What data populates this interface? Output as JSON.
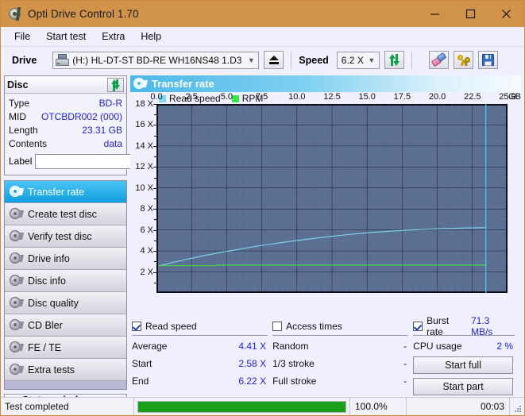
{
  "window": {
    "title": "Opti Drive Control 1.70",
    "minimize": "minimize-icon",
    "maximize": "maximize-icon",
    "close": "close-icon"
  },
  "menu": {
    "items": [
      {
        "label": "File"
      },
      {
        "label": "Start test"
      },
      {
        "label": "Extra"
      },
      {
        "label": "Help"
      }
    ]
  },
  "drivebar": {
    "drive_label": "Drive",
    "drive_value": "(H:)  HL-DT-ST BD-RE  WH16NS48 1.D3",
    "eject": "eject-button",
    "speed_label": "Speed",
    "speed_value": "6.2 X",
    "refresh": "refresh-button",
    "erase": "erase-button",
    "tools": "tools-button",
    "save": "save-button"
  },
  "disc": {
    "header": "Disc",
    "refresh": "refresh-disc-button",
    "rows": [
      {
        "key": "Type",
        "value": "BD-R"
      },
      {
        "key": "MID",
        "value": "OTCBDR002 (000)"
      },
      {
        "key": "Length",
        "value": "23.31 GB"
      },
      {
        "key": "Contents",
        "value": "data"
      }
    ],
    "label_key": "Label",
    "label_value": "",
    "label_placeholder": ""
  },
  "tabs": [
    {
      "label": "Transfer rate",
      "active": true
    },
    {
      "label": "Create test disc",
      "active": false
    },
    {
      "label": "Verify test disc",
      "active": false
    },
    {
      "label": "Drive info",
      "active": false
    },
    {
      "label": "Disc info",
      "active": false
    },
    {
      "label": "Disc quality",
      "active": false
    },
    {
      "label": "CD Bler",
      "active": false
    },
    {
      "label": "FE / TE",
      "active": false
    },
    {
      "label": "Extra tests",
      "active": false
    }
  ],
  "status_window_button": "Status window > >",
  "panel": {
    "title": "Transfer rate"
  },
  "chart_data": {
    "type": "line",
    "title": "Transfer rate",
    "xlabel": "GB",
    "ylabel": "X",
    "xlim": [
      0.0,
      25.0
    ],
    "ylim": [
      0,
      18
    ],
    "grid": true,
    "legend_position": "top-left",
    "x_unit": "GB",
    "xticks": [
      "0.0",
      "2.5",
      "5.0",
      "7.5",
      "10.0",
      "12.5",
      "15.0",
      "17.5",
      "20.0",
      "22.5",
      "25.0"
    ],
    "xtick_values": [
      0.0,
      2.5,
      5.0,
      7.5,
      10.0,
      12.5,
      15.0,
      17.5,
      20.0,
      22.5,
      25.0
    ],
    "yticks": [
      "2 X",
      "4 X",
      "6 X",
      "8 X",
      "10 X",
      "12 X",
      "14 X",
      "16 X",
      "18 X"
    ],
    "ytick_values": [
      2,
      4,
      6,
      8,
      10,
      12,
      14,
      16,
      18
    ],
    "plot_bg": "#5b6f92",
    "series": [
      {
        "name": "Read speed",
        "color": "#7fd8f5",
        "points": [
          [
            0.15,
            2.58
          ],
          [
            0.6,
            2.72
          ],
          [
            1.2,
            2.92
          ],
          [
            1.9,
            3.12
          ],
          [
            2.6,
            3.33
          ],
          [
            3.3,
            3.53
          ],
          [
            4.1,
            3.74
          ],
          [
            4.9,
            3.94
          ],
          [
            5.7,
            4.12
          ],
          [
            6.5,
            4.31
          ],
          [
            7.3,
            4.48
          ],
          [
            8.2,
            4.66
          ],
          [
            9.0,
            4.82
          ],
          [
            9.9,
            4.98
          ],
          [
            10.8,
            5.13
          ],
          [
            11.7,
            5.27
          ],
          [
            12.6,
            5.41
          ],
          [
            13.5,
            5.54
          ],
          [
            14.4,
            5.66
          ],
          [
            15.3,
            5.76
          ],
          [
            16.3,
            5.85
          ],
          [
            17.2,
            5.93
          ],
          [
            18.2,
            6.0
          ],
          [
            19.1,
            6.06
          ],
          [
            20.1,
            6.11
          ],
          [
            21.0,
            6.15
          ],
          [
            22.0,
            6.19
          ],
          [
            23.0,
            6.21
          ],
          [
            23.45,
            6.22
          ]
        ]
      },
      {
        "name": "RPM",
        "color": "#3ce54a",
        "points": [
          [
            0.15,
            2.6
          ],
          [
            2.0,
            2.6
          ],
          [
            4.2,
            2.6
          ],
          [
            4.4,
            2.66
          ],
          [
            10.0,
            2.66
          ],
          [
            16.0,
            2.66
          ],
          [
            23.45,
            2.66
          ]
        ]
      }
    ],
    "markers": [
      {
        "name": "end-marker",
        "x": 23.45,
        "color": "#3fd0f0"
      }
    ],
    "legend": [
      {
        "label": "Read speed",
        "color": "#7fd8f5"
      },
      {
        "label": "RPM",
        "color": "#3ce54a"
      }
    ]
  },
  "stats": {
    "read_speed": {
      "checkbox_label": "Read speed",
      "checked": true,
      "rows": [
        {
          "key": "Average",
          "value": "4.41 X"
        },
        {
          "key": "Start",
          "value": "2.58 X"
        },
        {
          "key": "End",
          "value": "6.22 X"
        }
      ]
    },
    "access_times": {
      "checkbox_label": "Access times",
      "checked": false,
      "rows": [
        {
          "key": "Random",
          "value": "-"
        },
        {
          "key": "1/3 stroke",
          "value": "-"
        },
        {
          "key": "Full stroke",
          "value": "-"
        }
      ]
    },
    "burst": {
      "checkbox_label": "Burst rate",
      "checked": true,
      "value": "71.3 MB/s",
      "cpu_key": "CPU usage",
      "cpu_value": "2 %"
    },
    "buttons": [
      {
        "label": "Start full"
      },
      {
        "label": "Start part"
      }
    ]
  },
  "statusbar": {
    "message": "Test completed",
    "percent_label": "100.0%",
    "percent_value": 100,
    "time": "00:03",
    "bar_color": "#19a019"
  }
}
